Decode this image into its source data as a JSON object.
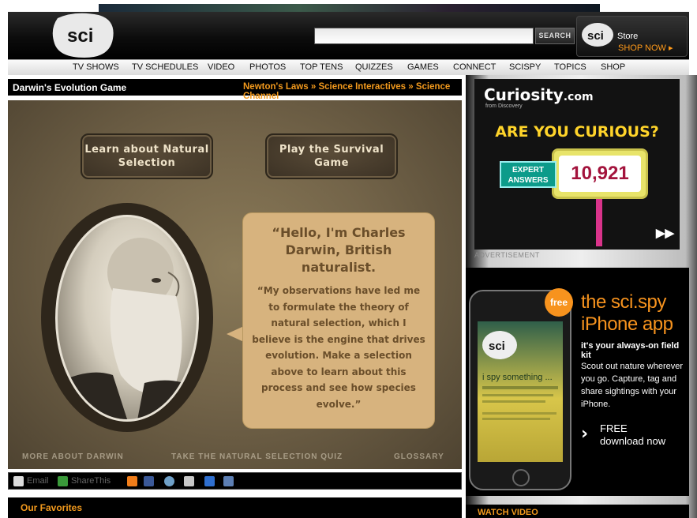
{
  "header": {
    "logo_text": "sci",
    "search_placeholder": "",
    "search_button": "SEARCH",
    "store": {
      "logo": "sci",
      "label": "Store",
      "cta": "SHOP NOW ▸"
    }
  },
  "nav": [
    "TV SHOWS",
    "TV SCHEDULES",
    "VIDEO",
    "PHOTOS",
    "TOP TENS",
    "QUIZZES",
    "GAMES",
    "CONNECT",
    "SCISPY",
    "TOPICS",
    "SHOP"
  ],
  "page": {
    "title": "Darwin's Evolution Game",
    "breadcrumb": [
      "Newton's Laws",
      "Science Interactives",
      "Science Channel"
    ],
    "breadcrumb_sep": "»"
  },
  "game": {
    "button_learn": "Learn about Natural Selection",
    "button_play": "Play the Survival Game",
    "hello": "“Hello, I'm Charles Darwin, British naturalist.",
    "body": "“My observations have led me to formulate the theory of natural selection, which I believe is the engine that drives evolution. Make a selection above to learn about this process and see how species evolve.”",
    "footer_links": [
      "MORE ABOUT DARWIN",
      "TAKE THE NATURAL SELECTION QUIZ",
      "GLOSSARY"
    ]
  },
  "share": {
    "email": "Email",
    "sharethis": "ShareThis"
  },
  "favorites": {
    "label": "Our Favorites"
  },
  "ad_curiosity": {
    "logo": "Curiosity",
    "logo_suffix": ".com",
    "sub": "from Discovery",
    "headline": "ARE YOU CURIOUS?",
    "badge": "EXPERT ANSWERS",
    "count": "10,921",
    "play_icon": "▶▶"
  },
  "advertisement_label": "ADVERTISEMENT",
  "ad_scispy": {
    "free_badge": "free",
    "title": "the sci.spy iPhone app",
    "tagline": "it's your always-on field kit",
    "desc": "Scout out nature wherever you go. Capture, tag and share sightings with your iPhone.",
    "cta": "FREE download now",
    "phone_screen_heading": "i spy something ...",
    "phone_logo": "sci"
  },
  "watch_video": {
    "label": "WATCH VIDEO"
  },
  "colors": {
    "accent_orange": "#f39a1d",
    "game_bg": "#736449",
    "bubble": "#d7b37e"
  }
}
